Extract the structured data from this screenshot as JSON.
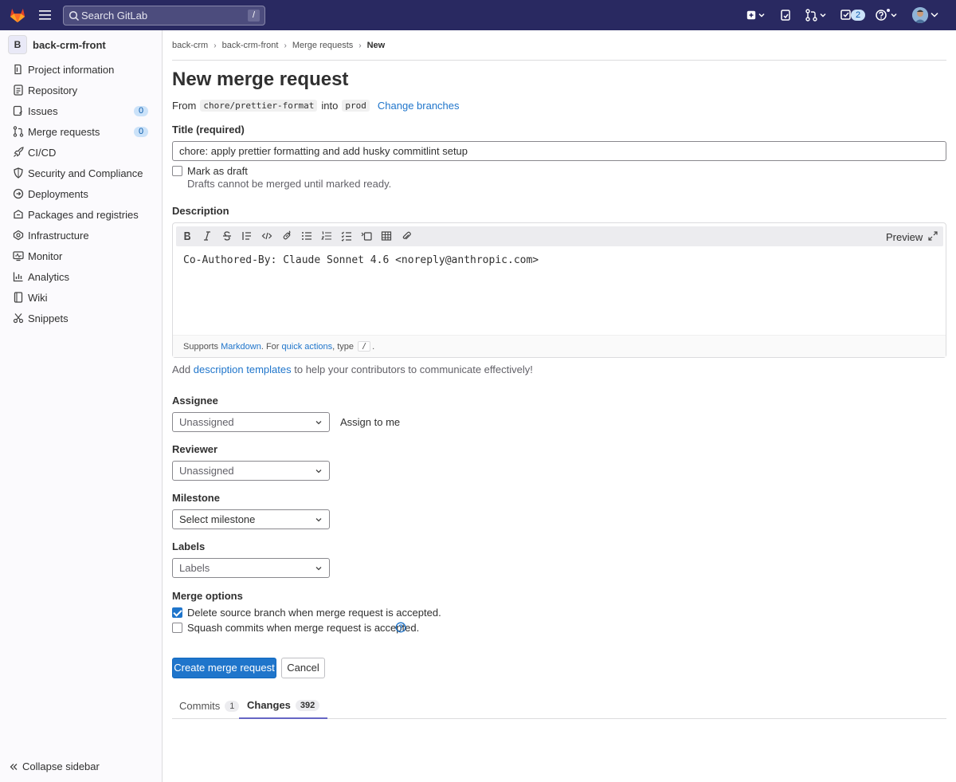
{
  "topbar": {
    "search_placeholder": "Search GitLab",
    "search_shortcut": "/",
    "todos_count": "2"
  },
  "sidebar": {
    "project_initial": "B",
    "project_name": "back-crm-front",
    "items": [
      {
        "label": "Project information",
        "icon": "project-icon"
      },
      {
        "label": "Repository",
        "icon": "doc-icon"
      },
      {
        "label": "Issues",
        "icon": "issues-icon",
        "count": "0"
      },
      {
        "label": "Merge requests",
        "icon": "merge-request-icon",
        "count": "0"
      },
      {
        "label": "CI/CD",
        "icon": "rocket-icon"
      },
      {
        "label": "Security and Compliance",
        "icon": "shield-icon"
      },
      {
        "label": "Deployments",
        "icon": "deployments-icon"
      },
      {
        "label": "Packages and registries",
        "icon": "package-icon"
      },
      {
        "label": "Infrastructure",
        "icon": "cloud-gear-icon"
      },
      {
        "label": "Monitor",
        "icon": "monitor-icon"
      },
      {
        "label": "Analytics",
        "icon": "chart-icon"
      },
      {
        "label": "Wiki",
        "icon": "book-icon"
      },
      {
        "label": "Snippets",
        "icon": "scissors-icon"
      }
    ],
    "collapse_label": "Collapse sidebar"
  },
  "breadcrumb": {
    "items": [
      "back-crm",
      "back-crm-front",
      "Merge requests"
    ],
    "current": "New"
  },
  "page": {
    "title": "New merge request",
    "from_label": "From",
    "source_branch": "chore/prettier-format",
    "into_label": "into",
    "target_branch": "prod",
    "change_branches": "Change branches"
  },
  "form": {
    "title_label": "Title (required)",
    "title_value": "chore: apply prettier formatting and add husky commitlint setup",
    "draft_label": "Mark as draft",
    "draft_help": "Drafts cannot be merged until marked ready.",
    "description_label": "Description",
    "preview_label": "Preview",
    "description_value": "Co-Authored-By: Claude Sonnet 4.6 <noreply@anthropic.com>",
    "footer_supports": "Supports",
    "footer_markdown": "Markdown",
    "footer_for": ". For",
    "footer_quick_actions": "quick actions",
    "footer_type": ", type",
    "footer_kbd": "/",
    "footer_end": ".",
    "templates_pre": "Add",
    "templates_link": "description templates",
    "templates_post": "to help your contributors to communicate effectively!",
    "assignee_label": "Assignee",
    "assignee_value": "Unassigned",
    "assign_to_me": "Assign to me",
    "reviewer_label": "Reviewer",
    "reviewer_value": "Unassigned",
    "milestone_label": "Milestone",
    "milestone_value": "Select milestone",
    "labels_label": "Labels",
    "labels_value": "Labels",
    "merge_options_label": "Merge options",
    "delete_branch_label": "Delete source branch when merge request is accepted.",
    "delete_branch_checked": true,
    "squash_label": "Squash commits when merge request is accepted.",
    "squash_checked": false,
    "create_button": "Create merge request",
    "cancel_button": "Cancel"
  },
  "tabs": [
    {
      "label": "Commits",
      "count": "1",
      "active": false
    },
    {
      "label": "Changes",
      "count": "392",
      "active": true
    }
  ],
  "colors": {
    "topbar": "#292961",
    "primary": "#1f75cb",
    "tab_active": "#6666c4"
  }
}
